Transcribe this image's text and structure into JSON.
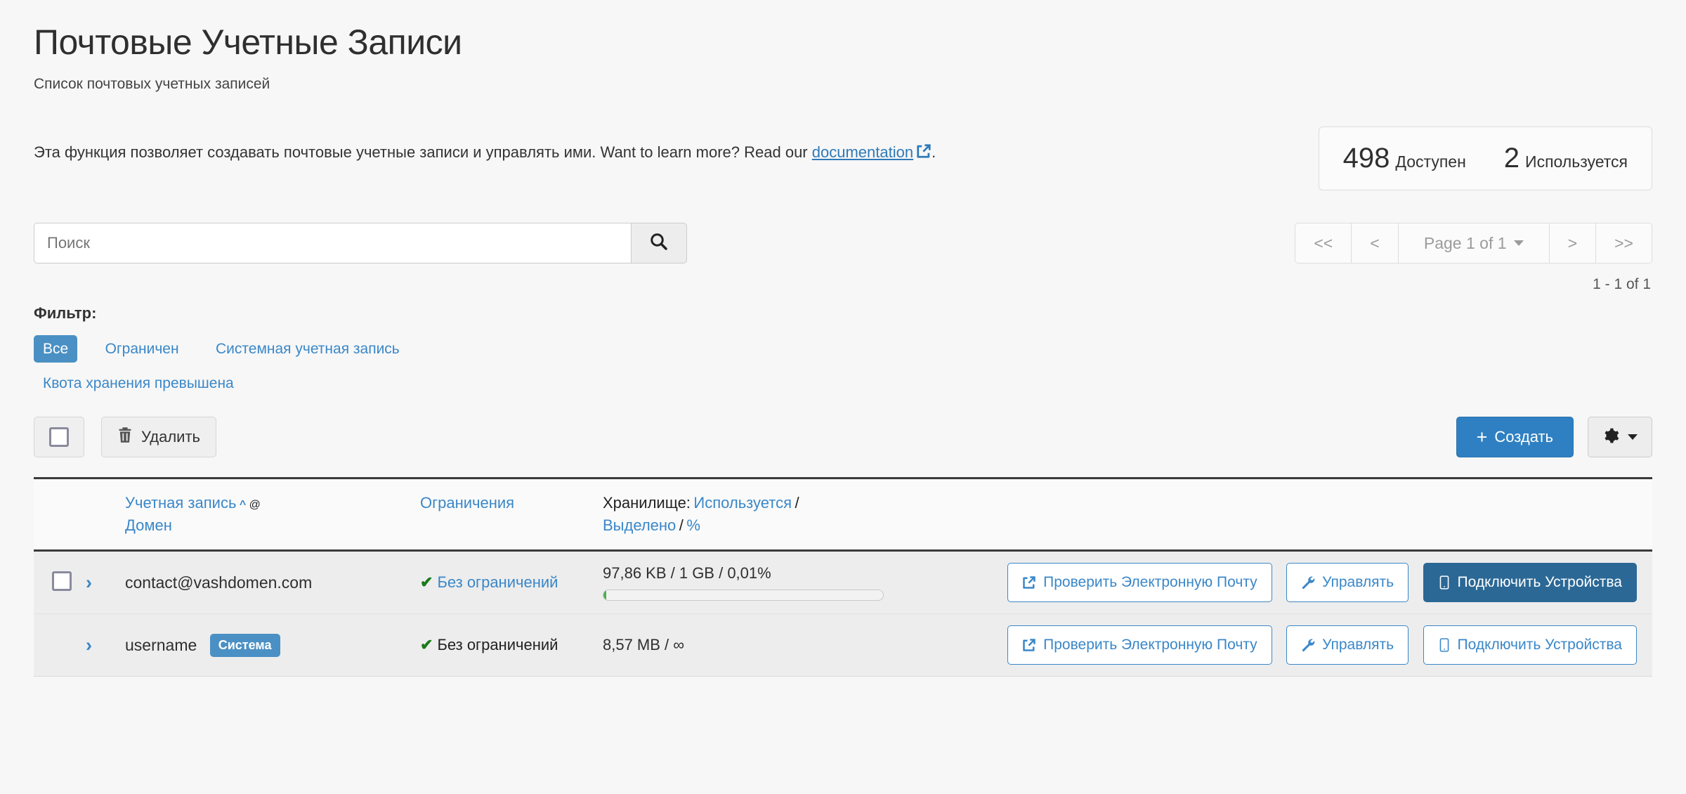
{
  "header": {
    "title": "Почтовые Учетные Записи",
    "subtitle": "Список почтовых учетных записей",
    "description_before": "Эта функция позволяет создавать почтовые учетные записи и управлять ими. Want to learn more? Read our ",
    "doc_link": "documentation",
    "description_after": "."
  },
  "stats": {
    "available_value": "498",
    "available_label": "Доступен",
    "used_value": "2",
    "used_label": "Используется"
  },
  "search": {
    "placeholder": "Поиск",
    "value": "",
    "icon": "search-icon"
  },
  "pagination": {
    "first": "<<",
    "prev": "<",
    "page_label": "Page 1 of 1",
    "next": ">",
    "last": ">>",
    "range": "1 - 1 of 1"
  },
  "filter": {
    "label": "Фильтр:",
    "chips": [
      {
        "label": "Все",
        "active": true
      },
      {
        "label": "Ограничен",
        "active": false
      },
      {
        "label": "Системная учетная запись",
        "active": false
      },
      {
        "label": "Квота хранения превышена",
        "active": false
      }
    ]
  },
  "toolbar": {
    "select_all": "",
    "delete_label": "Удалить",
    "create_label": "Создать",
    "create_plus": "+",
    "gear_icon": "gear-icon"
  },
  "table": {
    "columns": {
      "account_link": "Учетная запись",
      "sort_caret": "⌃",
      "at": "@",
      "domain_link": "Домен",
      "restrictions": "Ограничения",
      "storage_prefix": "Хранилище:",
      "storage_used": "Используется",
      "storage_allocated": "Выделено",
      "storage_percent": "%",
      "sep": "/"
    },
    "rows": [
      {
        "has_checkbox": true,
        "account": "contact@vashdomen.com",
        "badge": "",
        "restriction": "Без ограничений",
        "restriction_style": "link",
        "storage": "97,86 KB / 1 GB / 0,01%",
        "has_bar": true,
        "bar_percent": 1,
        "buttons": [
          {
            "label": "Проверить Электронную Почту",
            "icon": "external-link-icon",
            "filled": false
          },
          {
            "label": "Управлять",
            "icon": "wrench-icon",
            "filled": false
          },
          {
            "label": "Подключить Устройства",
            "icon": "mobile-icon",
            "filled": true
          }
        ]
      },
      {
        "has_checkbox": false,
        "account": "username",
        "badge": "Система",
        "restriction": "Без ограничений",
        "restriction_style": "plain",
        "storage": "8,57 MB / ∞",
        "has_bar": false,
        "bar_percent": 0,
        "buttons": [
          {
            "label": "Проверить Электронную Почту",
            "icon": "external-link-icon",
            "filled": false
          },
          {
            "label": "Управлять",
            "icon": "wrench-icon",
            "filled": false
          },
          {
            "label": "Подключить Устройства",
            "icon": "mobile-icon",
            "filled": false
          }
        ]
      }
    ]
  },
  "colors": {
    "accent_blue": "#3a87c8",
    "button_blue": "#2f80c2",
    "filled_blue": "#2b6896",
    "check_green": "#1a7a1a",
    "row_bg": "#ededed"
  }
}
